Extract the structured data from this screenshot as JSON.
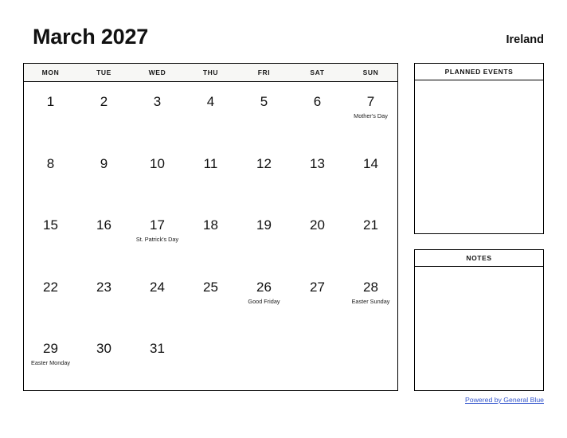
{
  "header": {
    "title": "March 2027",
    "country": "Ireland"
  },
  "calendar": {
    "weekdays": [
      "MON",
      "TUE",
      "WED",
      "THU",
      "FRI",
      "SAT",
      "SUN"
    ],
    "weeks": [
      [
        {
          "day": "1",
          "event": ""
        },
        {
          "day": "2",
          "event": ""
        },
        {
          "day": "3",
          "event": ""
        },
        {
          "day": "4",
          "event": ""
        },
        {
          "day": "5",
          "event": ""
        },
        {
          "day": "6",
          "event": ""
        },
        {
          "day": "7",
          "event": "Mother's Day"
        }
      ],
      [
        {
          "day": "8",
          "event": ""
        },
        {
          "day": "9",
          "event": ""
        },
        {
          "day": "10",
          "event": ""
        },
        {
          "day": "11",
          "event": ""
        },
        {
          "day": "12",
          "event": ""
        },
        {
          "day": "13",
          "event": ""
        },
        {
          "day": "14",
          "event": ""
        }
      ],
      [
        {
          "day": "15",
          "event": ""
        },
        {
          "day": "16",
          "event": ""
        },
        {
          "day": "17",
          "event": "St. Patrick's Day"
        },
        {
          "day": "18",
          "event": ""
        },
        {
          "day": "19",
          "event": ""
        },
        {
          "day": "20",
          "event": ""
        },
        {
          "day": "21",
          "event": ""
        }
      ],
      [
        {
          "day": "22",
          "event": ""
        },
        {
          "day": "23",
          "event": ""
        },
        {
          "day": "24",
          "event": ""
        },
        {
          "day": "25",
          "event": ""
        },
        {
          "day": "26",
          "event": "Good Friday"
        },
        {
          "day": "27",
          "event": ""
        },
        {
          "day": "28",
          "event": "Easter Sunday"
        }
      ],
      [
        {
          "day": "29",
          "event": "Easter Monday"
        },
        {
          "day": "30",
          "event": ""
        },
        {
          "day": "31",
          "event": ""
        },
        {
          "day": "",
          "event": ""
        },
        {
          "day": "",
          "event": ""
        },
        {
          "day": "",
          "event": ""
        },
        {
          "day": "",
          "event": ""
        }
      ]
    ]
  },
  "panels": {
    "planned_events_title": "PLANNED EVENTS",
    "notes_title": "NOTES"
  },
  "footer": {
    "link_text": "Powered by General Blue",
    "link_color": "#3355cc"
  }
}
